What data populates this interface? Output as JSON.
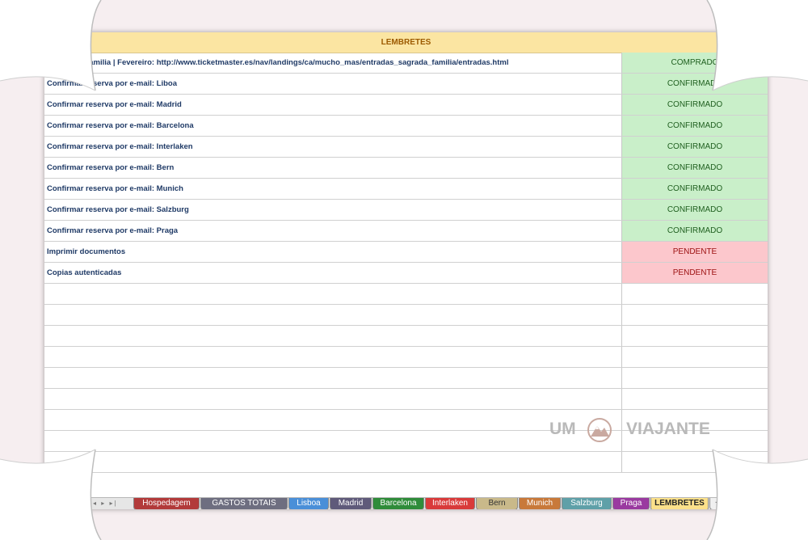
{
  "sheet": {
    "header": "LEMBRETES",
    "rows": [
      {
        "task": "r Sagrada Familia | Fevereiro: http://www.ticketmaster.es/nav/landings/ca/mucho_mas/entradas_sagrada_familia/entradas.html",
        "status": "COMPRADO",
        "state": "ok"
      },
      {
        "task": "Confirmar reserva por e-mail: Liboa",
        "status": "CONFIRMADO",
        "state": "ok"
      },
      {
        "task": "Confirmar reserva por e-mail: Madrid",
        "status": "CONFIRMADO",
        "state": "ok"
      },
      {
        "task": "Confirmar reserva por e-mail: Barcelona",
        "status": "CONFIRMADO",
        "state": "ok"
      },
      {
        "task": "Confirmar reserva por e-mail: Interlaken",
        "status": "CONFIRMADO",
        "state": "ok"
      },
      {
        "task": "Confirmar reserva por e-mail: Bern",
        "status": "CONFIRMADO",
        "state": "ok"
      },
      {
        "task": "Confirmar reserva por e-mail: Munich",
        "status": "CONFIRMADO",
        "state": "ok"
      },
      {
        "task": "Confirmar reserva por e-mail: Salzburg",
        "status": "CONFIRMADO",
        "state": "ok"
      },
      {
        "task": "Confirmar reserva por e-mail: Praga",
        "status": "CONFIRMADO",
        "state": "ok"
      },
      {
        "task": "Imprimir documentos",
        "status": "PENDENTE",
        "state": "pend"
      },
      {
        "task": "Copias autenticadas",
        "status": "PENDENTE",
        "state": "pend"
      }
    ],
    "empty_rows": 9
  },
  "tabs": [
    {
      "label": "Hospedagem",
      "color": "#b23a3a",
      "text": "#ffffff"
    },
    {
      "label": "GASTOS TOTAIS",
      "color": "#6e6e80",
      "text": "#ffffff"
    },
    {
      "label": "Lisboa",
      "color": "#4a8fd8",
      "text": "#ffffff"
    },
    {
      "label": "Madrid",
      "color": "#5f5a7a",
      "text": "#ffffff"
    },
    {
      "label": "Barcelona",
      "color": "#2f8c3a",
      "text": "#ffffff"
    },
    {
      "label": "Interlaken",
      "color": "#d93a3a",
      "text": "#ffffff"
    },
    {
      "label": "Bern",
      "color": "#c9b98a",
      "text": "#333333"
    },
    {
      "label": "Munich",
      "color": "#c8793a",
      "text": "#ffffff"
    },
    {
      "label": "Salzburg",
      "color": "#5fa0a8",
      "text": "#ffffff"
    },
    {
      "label": "Praga",
      "color": "#9a3aa0",
      "text": "#ffffff"
    },
    {
      "label": "LEMBRETES",
      "color": "#fbe08a",
      "text": "#222222",
      "active": true
    },
    {
      "label": "+",
      "color": "#f0f0f0",
      "text": "#333333"
    }
  ],
  "tab_nav": {
    "label": "◂ ▸ ▸|"
  },
  "watermark": {
    "left": "UM",
    "right": "VIAJANTE"
  }
}
